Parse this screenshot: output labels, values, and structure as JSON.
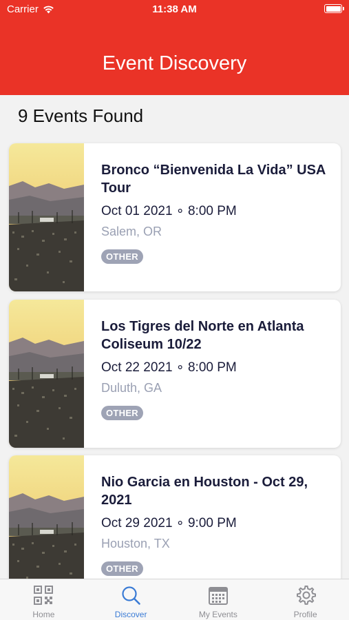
{
  "status_bar": {
    "carrier": "Carrier",
    "time": "11:38 AM"
  },
  "header": {
    "title": "Event Discovery",
    "color": "#ea3327"
  },
  "results": {
    "count_label": "9 Events Found"
  },
  "events": [
    {
      "title": "Bronco “Bienvenida La Vida” USA Tour",
      "datetime": "Oct 01 2021 ∘ 8:00 PM",
      "location": "Salem, OR",
      "tag": "OTHER"
    },
    {
      "title": "Los Tigres del Norte en Atlanta Coliseum 10/22",
      "datetime": "Oct 22 2021 ∘ 8:00 PM",
      "location": "Duluth, GA",
      "tag": "OTHER"
    },
    {
      "title": "Nio Garcia en Houston - Oct 29, 2021",
      "datetime": "Oct 29 2021 ∘ 9:00 PM",
      "location": "Houston, TX",
      "tag": "OTHER"
    }
  ],
  "tab_bar": {
    "active_color": "#3a7bd5",
    "items": [
      {
        "label": "Home",
        "icon": "qr-code-icon"
      },
      {
        "label": "Discover",
        "icon": "search-icon"
      },
      {
        "label": "My Events",
        "icon": "calendar-icon"
      },
      {
        "label": "Profile",
        "icon": "gear-icon"
      }
    ]
  }
}
